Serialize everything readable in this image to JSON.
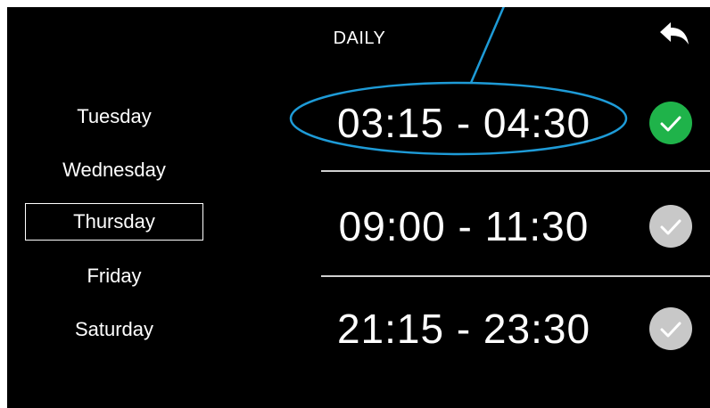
{
  "header": {
    "title": "DAILY",
    "back_icon": "back-arrow-icon"
  },
  "days": [
    {
      "label": "Tuesday",
      "selected": false
    },
    {
      "label": "Wednesday",
      "selected": false
    },
    {
      "label": "Thursday",
      "selected": true
    },
    {
      "label": "Friday",
      "selected": false
    },
    {
      "label": "Saturday",
      "selected": false
    }
  ],
  "slots": [
    {
      "time": "03:15 - 04:30",
      "enabled": true,
      "check_color": "#1fb34a",
      "check_icon": "checkmark-icon"
    },
    {
      "time": "09:00 - 11:30",
      "enabled": false,
      "check_color": "#c8c8c8",
      "check_icon": "checkmark-icon"
    },
    {
      "time": "21:15 - 23:30",
      "enabled": false,
      "check_color": "#c8c8c8",
      "check_icon": "checkmark-icon"
    }
  ],
  "colors": {
    "background": "#000000",
    "text": "#ffffff",
    "annotation": "#1e9bd7",
    "enabled": "#1fb34a",
    "disabled": "#c8c8c8"
  }
}
